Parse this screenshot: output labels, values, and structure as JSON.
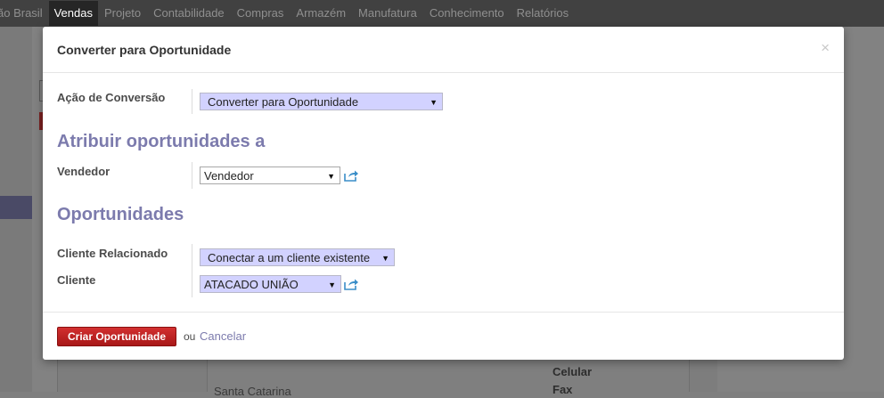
{
  "topnav": {
    "items": [
      "ão Brasil",
      "Vendas",
      "Projeto",
      "Contabilidade",
      "Compras",
      "Armazém",
      "Manufatura",
      "Conhecimento",
      "Relatórios"
    ],
    "active_index": 1
  },
  "background": {
    "label_celular": "Celular",
    "label_fax": "Fax",
    "text_santa_catarina": "Santa Catarina"
  },
  "dialog": {
    "title": "Converter para Oportunidade",
    "close_glyph": "×",
    "conversion_action": {
      "label": "Ação de Conversão",
      "selected": "Converter para Oportunidade"
    },
    "section_assign": "Atribuir oportunidades a",
    "salesperson": {
      "label": "Vendedor",
      "selected": "Vendedor"
    },
    "section_opportunities": "Oportunidades",
    "related_customer": {
      "label": "Cliente Relacionado",
      "selected": "Conectar a um cliente existente"
    },
    "customer": {
      "label": "Cliente",
      "selected": "ATACADO UNIÃO"
    },
    "footer": {
      "create_button": "Criar Oportunidade",
      "or_text": "ou",
      "cancel_link": "Cancelar"
    }
  },
  "colors": {
    "topbar_bg": "#414141",
    "accent": "#7c7bad",
    "select_bg": "#d2d2ff",
    "primary_button": "#b81c1c",
    "link_icon": "#3a8ec8"
  },
  "icons": {
    "select_arrow": "▼",
    "external_link": "external-link-icon"
  }
}
